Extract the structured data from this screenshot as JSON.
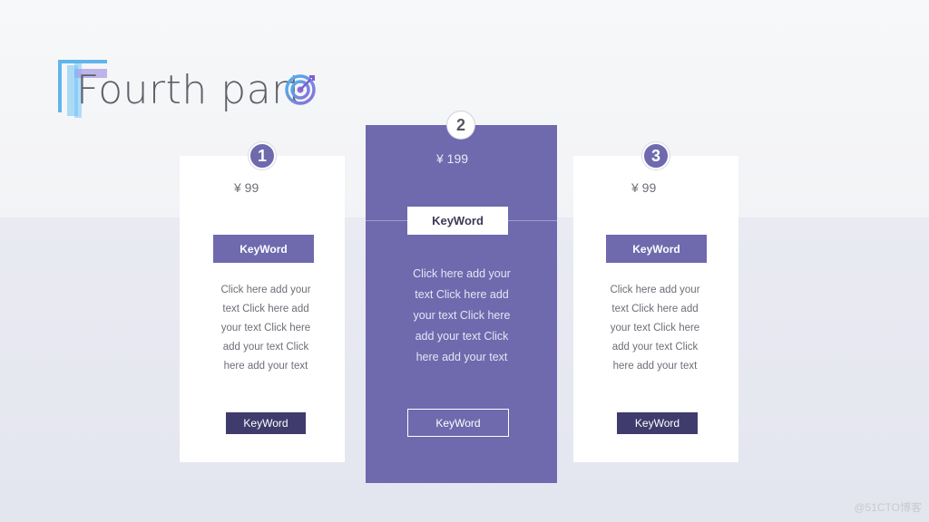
{
  "title": {
    "text": "Fourth part"
  },
  "cards": [
    {
      "number": "1",
      "price": "¥ 99",
      "keyword_top": "KeyWord",
      "description": "Click here add your text Click here add your text Click here add your text Click here add your text",
      "keyword_bottom": "KeyWord"
    },
    {
      "number": "2",
      "price": "¥ 199",
      "keyword_top": "KeyWord",
      "description": "Click here add your text Click here add your text Click here add your text Click here add your text",
      "keyword_bottom": "KeyWord"
    },
    {
      "number": "3",
      "price": "¥ 99",
      "keyword_top": "KeyWord",
      "description": "Click here add your text Click here add your text Click here add your text Click here add your text",
      "keyword_bottom": "KeyWord"
    }
  ],
  "watermark": "@51CTO博客",
  "colors": {
    "accent": "#6f69ae",
    "dark_button": "#3f3b6c",
    "title_text": "#5d6068",
    "body_text": "#6c6f77"
  },
  "icons": {
    "title_icon": "target-icon",
    "title_deco": "f-letter-deco"
  }
}
